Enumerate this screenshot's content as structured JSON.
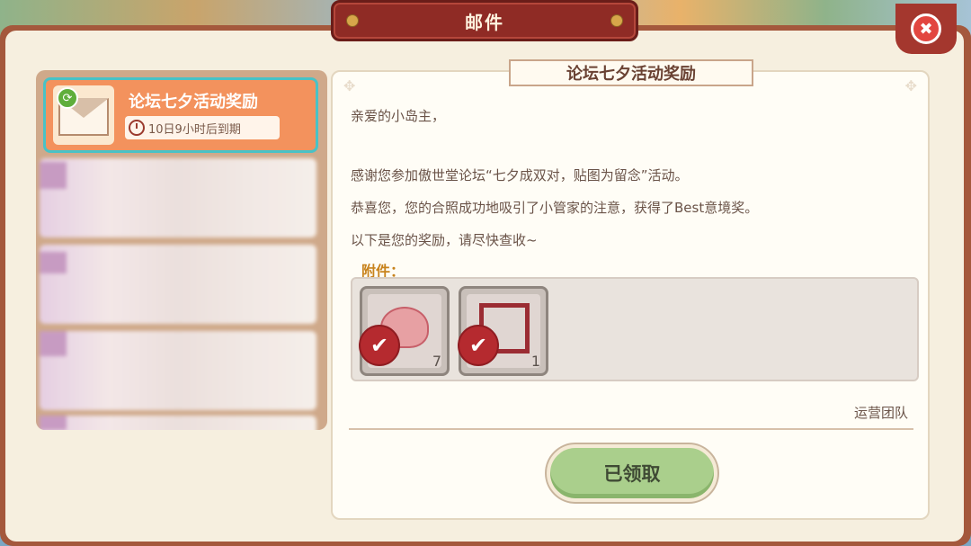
{
  "window": {
    "title": "邮件",
    "close_glyph": "✖"
  },
  "mail_list": {
    "selected": {
      "title": "论坛七夕活动奖励",
      "expire_text": "10日9小时后到期",
      "icon": "envelope-icon",
      "badge_icon": "recycle-icon"
    }
  },
  "mail": {
    "subject": "论坛七夕活动奖励",
    "greeting": "亲爱的小岛主，",
    "lines": [
      "感谢您参加傲世堂论坛“七夕成双对，贴图为留念”活动。",
      "恭喜您，您的合照成功地吸引了小管家的注意，获得了Best意境奖。",
      "以下是您的奖励，请尽快查收~"
    ],
    "attachments_label": "附件：",
    "attachments": [
      {
        "icon": "cake-icon",
        "qty": "7"
      },
      {
        "icon": "photo-frame-icon",
        "qty": "1"
      }
    ],
    "signature": "运营团队",
    "claim_button": "已领取"
  },
  "colors": {
    "accent": "#8f2b25",
    "selected_item": "#f3925d",
    "claim": "#aacf8c"
  }
}
